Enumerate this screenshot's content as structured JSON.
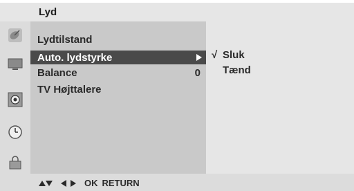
{
  "title": "Lyd",
  "rail_icons": [
    "satellite-dish-icon",
    "tv-screen-icon",
    "speaker-icon",
    "clock-icon",
    "lock-icon"
  ],
  "menu": {
    "items": [
      {
        "label": "Lydtilstand",
        "value": ""
      },
      {
        "label": "Auto. lydstyrke",
        "value": ""
      },
      {
        "label": "Balance",
        "value": "0"
      },
      {
        "label": "TV Højttalere",
        "value": ""
      }
    ],
    "selected_index": 1
  },
  "submenu": {
    "items": [
      {
        "check": "√",
        "label": "Sluk"
      },
      {
        "check": "",
        "label": "Tænd"
      }
    ]
  },
  "footer": {
    "ok_label": "OK",
    "return_label": "RETURN"
  },
  "colors": {
    "title_bar": "#e6e6e6",
    "menu_bg": "#c9c9c9",
    "selected_bg": "#4a4a4a",
    "submenu_bg": "#e6e6e6"
  }
}
